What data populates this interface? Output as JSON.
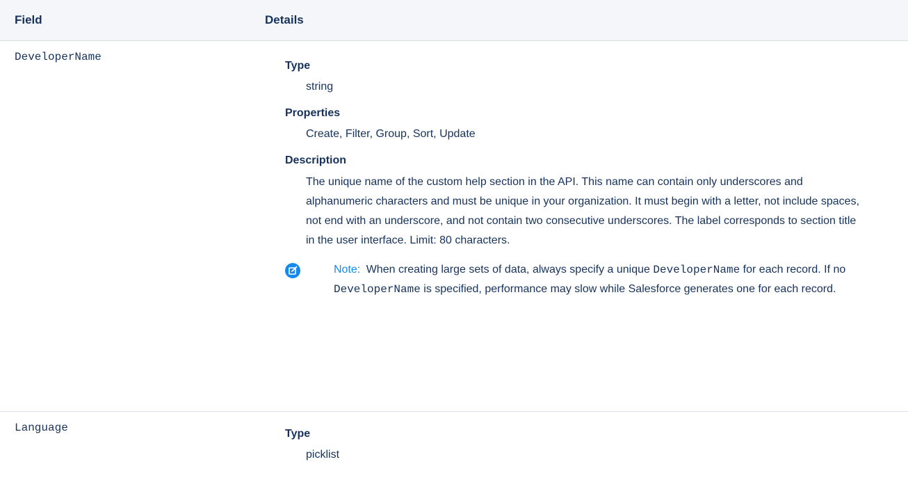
{
  "table": {
    "headers": {
      "field": "Field",
      "details": "Details"
    },
    "rows": [
      {
        "field": "DeveloperName",
        "type_label": "Type",
        "type_value": "string",
        "properties_label": "Properties",
        "properties_value": "Create, Filter, Group, Sort, Update",
        "description_label": "Description",
        "description_value": "The unique name of the custom help section in the API. This name can contain only underscores and alphanumeric characters and must be unique in your organization. It must begin with a letter, not include spaces, not end with an underscore, and not contain two consecutive underscores. The label corresponds to section title in the user interface. Limit: 80 characters.",
        "note": {
          "icon": "edit-note-icon",
          "label": "Note:",
          "text_1": "When creating large sets of data, always specify a unique",
          "code_1": "DeveloperName",
          "text_2": "for each record. If no",
          "code_2": "DeveloperName",
          "text_3": "is specified, performance may slow while Salesforce generates one for each record."
        }
      },
      {
        "field": "Language",
        "type_label": "Type",
        "type_value": "picklist"
      }
    ]
  },
  "colors": {
    "text": "#16325c",
    "header_bg": "#f4f6f9",
    "divider": "#d8dde6",
    "note_accent": "#1589ee"
  }
}
